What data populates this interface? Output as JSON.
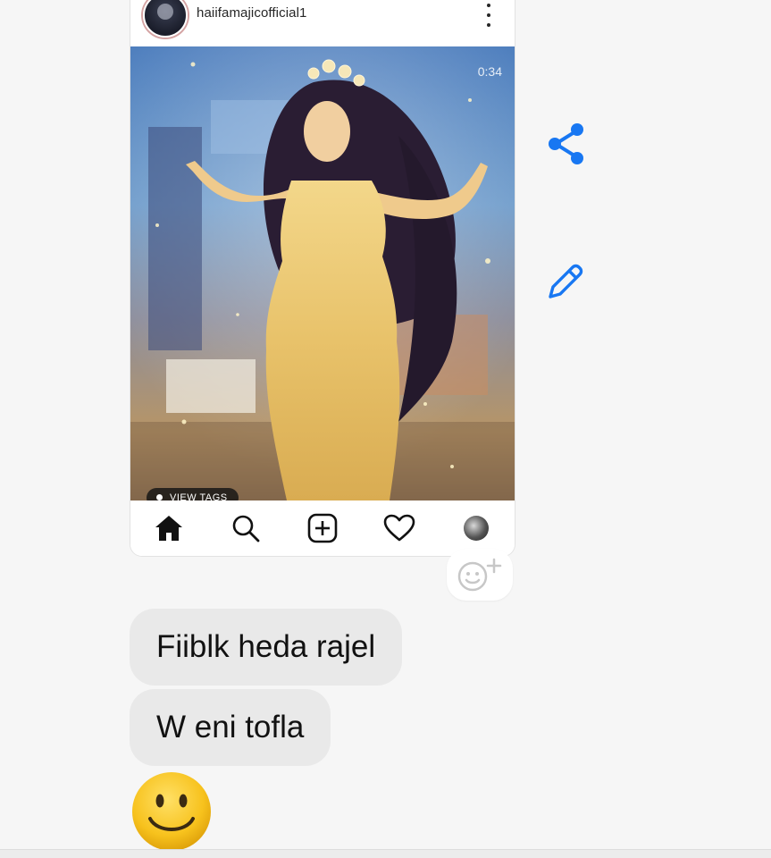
{
  "post": {
    "username": "haiifamajicofficial1",
    "media_time": "0:34",
    "view_tags_label": "VIEW TAGS"
  },
  "messages": [
    {
      "text": "Fiiblk heda rajel"
    },
    {
      "text": "W eni tofla"
    }
  ],
  "icons": {
    "share": "share-icon",
    "edit": "pencil-icon",
    "home": "home-icon",
    "search": "search-icon",
    "add": "add-post-icon",
    "activity": "heart-icon",
    "profile": "profile-avatar",
    "react": "add-reaction-icon",
    "smile": "smiling-face-emoji"
  },
  "colors": {
    "accent_blue": "#1877f2",
    "bubble_bg": "#e9e9e9",
    "emoji_yellow": "#f7c21d"
  }
}
